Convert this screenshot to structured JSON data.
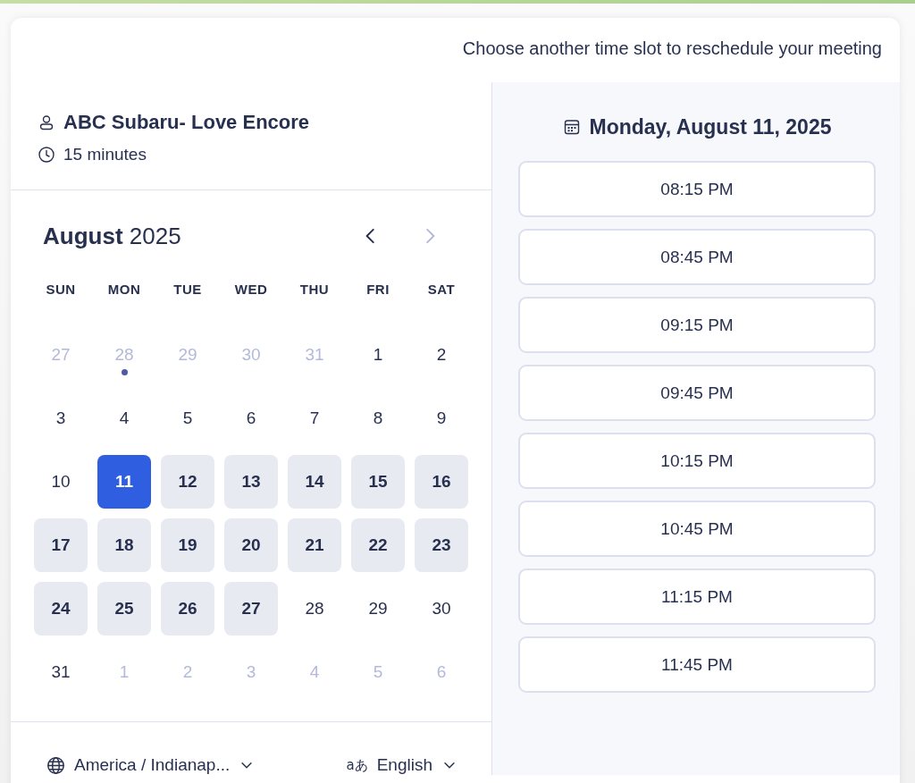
{
  "header": {
    "text": "Choose another time slot to reschedule your meeting"
  },
  "meeting": {
    "title": "ABC Subaru- Love Encore",
    "duration": "15 minutes"
  },
  "calendar": {
    "month": "August",
    "year": "2025",
    "prev_disabled": false,
    "next_disabled": true,
    "weekdays": [
      "SUN",
      "MON",
      "TUE",
      "WED",
      "THU",
      "FRI",
      "SAT"
    ],
    "days": [
      {
        "label": "27",
        "muted": true,
        "available": false,
        "selected": false,
        "marked": false
      },
      {
        "label": "28",
        "muted": true,
        "available": false,
        "selected": false,
        "marked": true
      },
      {
        "label": "29",
        "muted": true,
        "available": false,
        "selected": false,
        "marked": false
      },
      {
        "label": "30",
        "muted": true,
        "available": false,
        "selected": false,
        "marked": false
      },
      {
        "label": "31",
        "muted": true,
        "available": false,
        "selected": false,
        "marked": false
      },
      {
        "label": "1",
        "muted": false,
        "available": false,
        "selected": false,
        "marked": false
      },
      {
        "label": "2",
        "muted": false,
        "available": false,
        "selected": false,
        "marked": false
      },
      {
        "label": "3",
        "muted": false,
        "available": false,
        "selected": false,
        "marked": false
      },
      {
        "label": "4",
        "muted": false,
        "available": false,
        "selected": false,
        "marked": false
      },
      {
        "label": "5",
        "muted": false,
        "available": false,
        "selected": false,
        "marked": false
      },
      {
        "label": "6",
        "muted": false,
        "available": false,
        "selected": false,
        "marked": false
      },
      {
        "label": "7",
        "muted": false,
        "available": false,
        "selected": false,
        "marked": false
      },
      {
        "label": "8",
        "muted": false,
        "available": false,
        "selected": false,
        "marked": false
      },
      {
        "label": "9",
        "muted": false,
        "available": false,
        "selected": false,
        "marked": false
      },
      {
        "label": "10",
        "muted": false,
        "available": false,
        "selected": false,
        "marked": false
      },
      {
        "label": "11",
        "muted": false,
        "available": true,
        "selected": true,
        "marked": false
      },
      {
        "label": "12",
        "muted": false,
        "available": true,
        "selected": false,
        "marked": false
      },
      {
        "label": "13",
        "muted": false,
        "available": true,
        "selected": false,
        "marked": false
      },
      {
        "label": "14",
        "muted": false,
        "available": true,
        "selected": false,
        "marked": false
      },
      {
        "label": "15",
        "muted": false,
        "available": true,
        "selected": false,
        "marked": false
      },
      {
        "label": "16",
        "muted": false,
        "available": true,
        "selected": false,
        "marked": false
      },
      {
        "label": "17",
        "muted": false,
        "available": true,
        "selected": false,
        "marked": false
      },
      {
        "label": "18",
        "muted": false,
        "available": true,
        "selected": false,
        "marked": false
      },
      {
        "label": "19",
        "muted": false,
        "available": true,
        "selected": false,
        "marked": false
      },
      {
        "label": "20",
        "muted": false,
        "available": true,
        "selected": false,
        "marked": false
      },
      {
        "label": "21",
        "muted": false,
        "available": true,
        "selected": false,
        "marked": false
      },
      {
        "label": "22",
        "muted": false,
        "available": true,
        "selected": false,
        "marked": false
      },
      {
        "label": "23",
        "muted": false,
        "available": true,
        "selected": false,
        "marked": false
      },
      {
        "label": "24",
        "muted": false,
        "available": true,
        "selected": false,
        "marked": false
      },
      {
        "label": "25",
        "muted": false,
        "available": true,
        "selected": false,
        "marked": false
      },
      {
        "label": "26",
        "muted": false,
        "available": true,
        "selected": false,
        "marked": false
      },
      {
        "label": "27",
        "muted": false,
        "available": true,
        "selected": false,
        "marked": false
      },
      {
        "label": "28",
        "muted": false,
        "available": false,
        "selected": false,
        "marked": false
      },
      {
        "label": "29",
        "muted": false,
        "available": false,
        "selected": false,
        "marked": false
      },
      {
        "label": "30",
        "muted": false,
        "available": false,
        "selected": false,
        "marked": false
      },
      {
        "label": "31",
        "muted": false,
        "available": false,
        "selected": false,
        "marked": false
      },
      {
        "label": "1",
        "muted": true,
        "available": false,
        "selected": false,
        "marked": false
      },
      {
        "label": "2",
        "muted": true,
        "available": false,
        "selected": false,
        "marked": false
      },
      {
        "label": "3",
        "muted": true,
        "available": false,
        "selected": false,
        "marked": false
      },
      {
        "label": "4",
        "muted": true,
        "available": false,
        "selected": false,
        "marked": false
      },
      {
        "label": "5",
        "muted": true,
        "available": false,
        "selected": false,
        "marked": false
      },
      {
        "label": "6",
        "muted": true,
        "available": false,
        "selected": false,
        "marked": false
      }
    ]
  },
  "footer": {
    "timezone": "America / Indianap...",
    "language_icon": "aあ",
    "language": "English"
  },
  "slots": {
    "date": "Monday, August 11, 2025",
    "times": [
      "08:15 PM",
      "08:45 PM",
      "09:15 PM",
      "09:45 PM",
      "10:15 PM",
      "10:45 PM",
      "11:15 PM",
      "11:45 PM"
    ]
  }
}
